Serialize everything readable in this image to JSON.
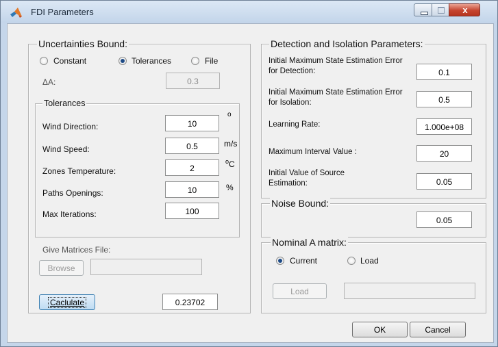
{
  "window": {
    "title": "FDI Parameters",
    "close_glyph": "x",
    "icon": "matlab-logo"
  },
  "uncertainties": {
    "title": "Uncertainties Bound:",
    "options": {
      "constant": "Constant",
      "tolerances": "Tolerances",
      "file": "File"
    },
    "selected": "Tolerances",
    "delta_a_label": "ΔA:",
    "delta_a_value": "0.3"
  },
  "tolerances": {
    "title": "Tolerances",
    "wind_direction": {
      "label": "Wind Direction:",
      "value": "10",
      "unit": "o"
    },
    "wind_speed": {
      "label": "Wind Speed:",
      "value": "0.5",
      "unit": "m/s"
    },
    "zones_temperature": {
      "label": "Zones Temperature:",
      "value": "2",
      "unit_sup": "o",
      "unit": "C"
    },
    "paths_openings": {
      "label": "Paths Openings:",
      "value": "10",
      "unit": "%"
    },
    "max_iterations": {
      "label": "Max Iterations:",
      "value": "100"
    }
  },
  "matrices": {
    "label": "Give Matrices File:",
    "browse": "Browse",
    "path": ""
  },
  "calculate": {
    "label": "Caclulate",
    "result": "0.23702"
  },
  "detection": {
    "title": "Detection and Isolation Parameters:",
    "detection_error": {
      "label": "Initial Maximum State Estimation Error for Detection:",
      "value": "0.1"
    },
    "isolation_error": {
      "label": "Initial Maximum State Estimation Error for Isolation:",
      "value": "0.5"
    },
    "learning_rate": {
      "label": "Learning Rate:",
      "value": "1.000e+08"
    },
    "max_interval": {
      "label": "Maximum Interval Value :",
      "value": "20"
    },
    "source_estimation": {
      "label": "Initial Value of Source Estimation:",
      "value": "0.05"
    }
  },
  "noise": {
    "title": "Noise Bound:",
    "value": "0.05"
  },
  "nominal": {
    "title": "Nominal A matrix:",
    "options": {
      "current": "Current",
      "load": "Load"
    },
    "selected": "Current",
    "load_button": "Load",
    "path": ""
  },
  "footer": {
    "ok": "OK",
    "cancel": "Cancel"
  },
  "colors": {
    "accent": "#1d4a86",
    "close_button": "#c6442f",
    "titlebar": "#c3d5ea"
  }
}
